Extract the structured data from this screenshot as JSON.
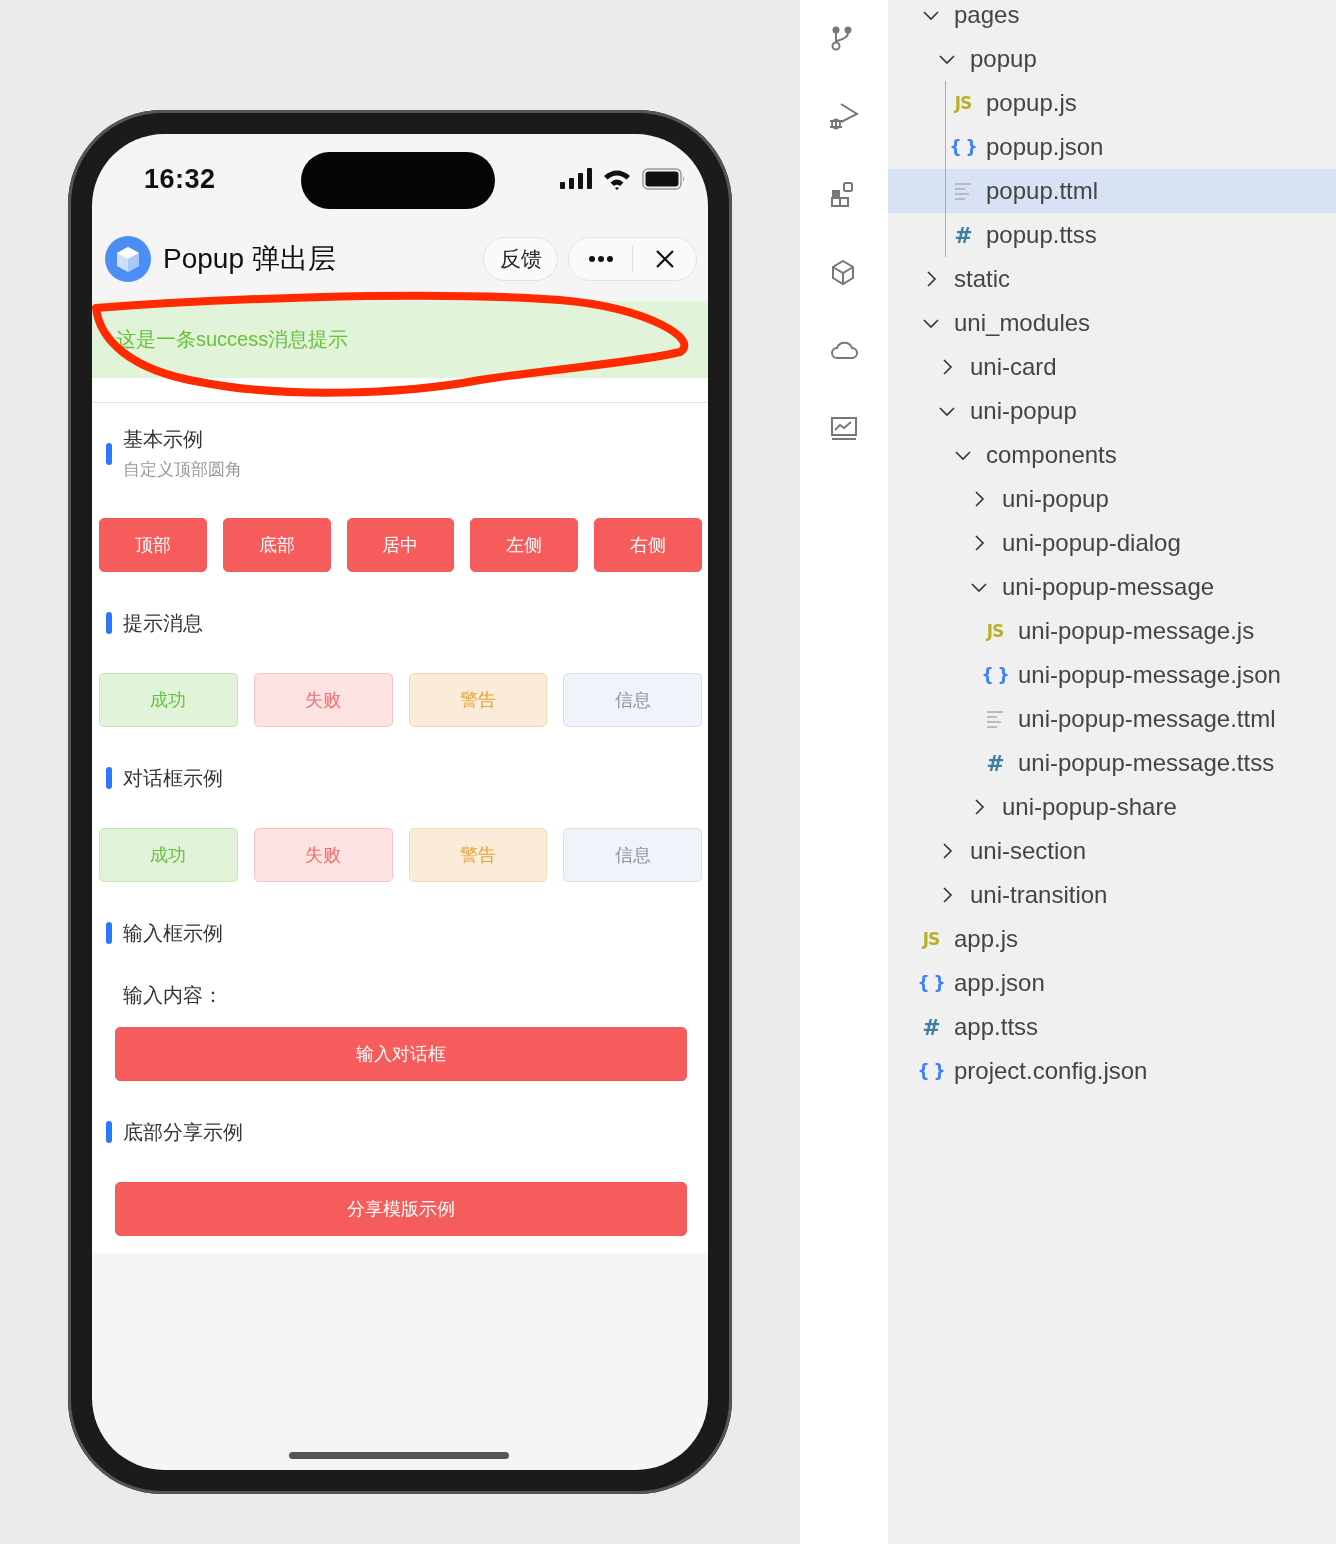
{
  "phone": {
    "status_bar": {
      "time": "16:32"
    },
    "nav_bar": {
      "title": "Popup 弹出层",
      "feedback_button": "反馈"
    },
    "message": {
      "kind": "success",
      "text": "这是一条success消息提示"
    },
    "annotation": {
      "kind": "loop"
    },
    "sections": [
      {
        "title": "基本示例",
        "subtitle": "自定义顶部圆角",
        "kind": "grid",
        "buttons": [
          {
            "label": "顶部",
            "kind": "primary"
          },
          {
            "label": "底部",
            "kind": "primary"
          },
          {
            "label": "居中",
            "kind": "primary"
          },
          {
            "label": "左侧",
            "kind": "primary"
          },
          {
            "label": "右侧",
            "kind": "primary"
          }
        ]
      },
      {
        "title": "提示消息",
        "kind": "grid",
        "buttons": [
          {
            "label": "成功",
            "kind": "success"
          },
          {
            "label": "失败",
            "kind": "error"
          },
          {
            "label": "警告",
            "kind": "warning"
          },
          {
            "label": "信息",
            "kind": "info"
          }
        ]
      },
      {
        "title": "对话框示例",
        "kind": "grid",
        "buttons": [
          {
            "label": "成功",
            "kind": "success"
          },
          {
            "label": "失败",
            "kind": "error"
          },
          {
            "label": "警告",
            "kind": "warning"
          },
          {
            "label": "信息",
            "kind": "info"
          }
        ]
      },
      {
        "title": "输入框示例",
        "kind": "stack",
        "input_label": "输入内容：",
        "buttons": [
          {
            "label": "输入对话框",
            "kind": "primary"
          }
        ]
      },
      {
        "title": "底部分享示例",
        "kind": "stack",
        "buttons": [
          {
            "label": "分享模版示例",
            "kind": "primary"
          }
        ]
      }
    ]
  },
  "explorer": {
    "tree": [
      {
        "label": "pages",
        "kind": "folder",
        "expanded": true,
        "selected": false,
        "children": [
          {
            "label": "popup",
            "kind": "folder",
            "expanded": true,
            "selected": false,
            "children": [
              {
                "label": "popup.js",
                "kind": "js",
                "icon": "JS",
                "selected": false
              },
              {
                "label": "popup.json",
                "kind": "json",
                "icon": "{ }",
                "selected": false
              },
              {
                "label": "popup.ttml",
                "kind": "ttml",
                "selected": true
              },
              {
                "label": "popup.ttss",
                "kind": "ttss",
                "icon": "#",
                "selected": false
              }
            ]
          }
        ]
      },
      {
        "label": "static",
        "kind": "folder",
        "expanded": false,
        "selected": false
      },
      {
        "label": "uni_modules",
        "kind": "folder",
        "expanded": true,
        "selected": false,
        "children": [
          {
            "label": "uni-card",
            "kind": "folder",
            "expanded": false,
            "selected": false
          },
          {
            "label": "uni-popup",
            "kind": "folder",
            "expanded": true,
            "selected": false,
            "children": [
              {
                "label": "components",
                "kind": "folder",
                "expanded": true,
                "selected": false,
                "children": [
                  {
                    "label": "uni-popup",
                    "kind": "folder",
                    "expanded": false,
                    "selected": false
                  },
                  {
                    "label": "uni-popup-dialog",
                    "kind": "folder",
                    "expanded": false,
                    "selected": false
                  },
                  {
                    "label": "uni-popup-message",
                    "kind": "folder",
                    "expanded": true,
                    "selected": false,
                    "children": [
                      {
                        "label": "uni-popup-message.js",
                        "kind": "js",
                        "icon": "JS",
                        "selected": false
                      },
                      {
                        "label": "uni-popup-message.json",
                        "kind": "json",
                        "icon": "{ }",
                        "selected": false
                      },
                      {
                        "label": "uni-popup-message.ttml",
                        "kind": "ttml",
                        "selected": false
                      },
                      {
                        "label": "uni-popup-message.ttss",
                        "kind": "ttss",
                        "icon": "#",
                        "selected": false
                      }
                    ]
                  },
                  {
                    "label": "uni-popup-share",
                    "kind": "folder",
                    "expanded": false,
                    "selected": false
                  }
                ]
              }
            ]
          },
          {
            "label": "uni-section",
            "kind": "folder",
            "expanded": false,
            "selected": false
          },
          {
            "label": "uni-transition",
            "kind": "folder",
            "expanded": false,
            "selected": false
          }
        ]
      },
      {
        "label": "app.js",
        "kind": "js",
        "icon": "JS",
        "selected": false
      },
      {
        "label": "app.json",
        "kind": "json",
        "icon": "{ }",
        "selected": false
      },
      {
        "label": "app.ttss",
        "kind": "ttss",
        "icon": "#",
        "selected": false
      },
      {
        "label": "project.config.json",
        "kind": "json",
        "icon": "{ }",
        "selected": false
      }
    ]
  }
}
